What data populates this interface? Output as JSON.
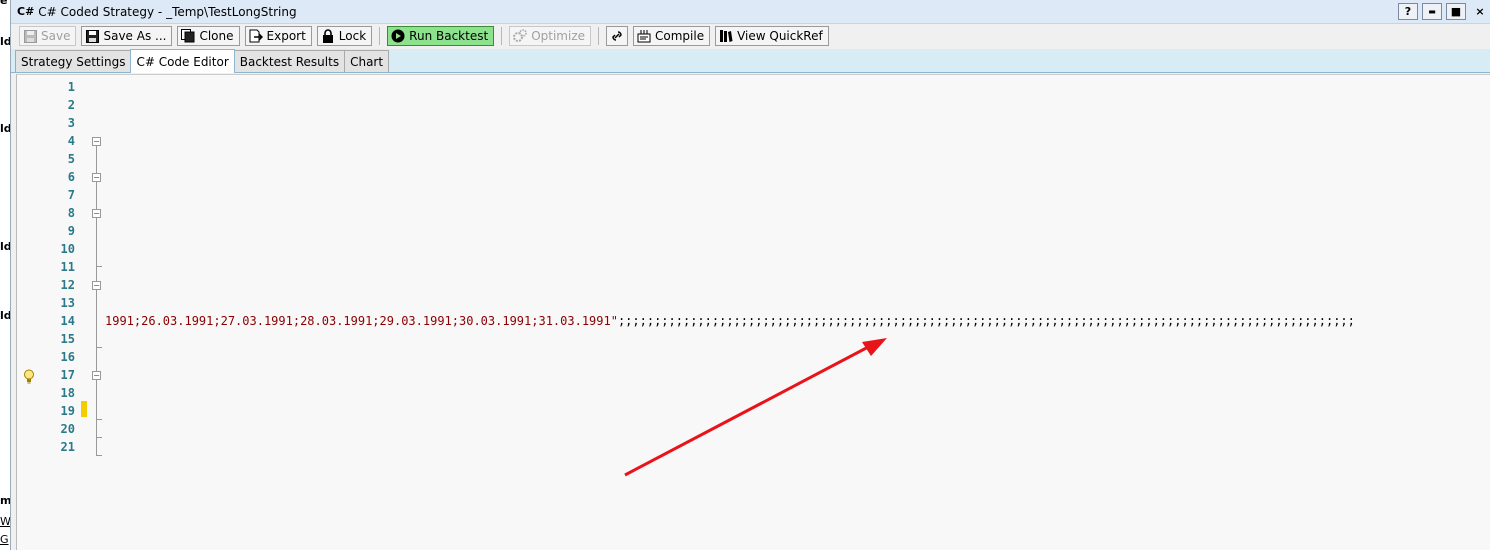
{
  "background_fragments": [
    "e",
    "ld",
    "ld",
    "ld",
    "ld",
    "m",
    "W",
    "G"
  ],
  "title": {
    "icon": "C#",
    "text": "C# Coded Strategy - _Temp\\TestLongString"
  },
  "window_controls": {
    "help": "?",
    "minimize": "▬",
    "maximize": "■",
    "close": "×"
  },
  "toolbar": {
    "save": "Save",
    "save_as": "Save As ...",
    "clone": "Clone",
    "export": "Export",
    "lock": "Lock",
    "run_backtest": "Run Backtest",
    "optimize": "Optimize",
    "compile": "Compile",
    "view_quickref": "View QuickRef"
  },
  "tabs": [
    {
      "label": "Strategy Settings"
    },
    {
      "label": "C# Code Editor"
    },
    {
      "label": "Backtest Results"
    },
    {
      "label": "Chart"
    }
  ],
  "editor": {
    "line_numbers": [
      "1",
      "2",
      "3",
      "4",
      "5",
      "6",
      "7",
      "8",
      "9",
      "10",
      "11",
      "12",
      "13",
      "14",
      "15",
      "16",
      "17",
      "18",
      "19",
      "20",
      "21"
    ],
    "line_14_text": "1991;26.03.1991;27.03.1991;28.03.1991;29.03.1991;30.03.1991;31.03.1991\"",
    "line_14_tail": ";;;;;;;;;;;;;;;;;;;;;;;;;;;;;;;;;;;;;;;;;;;;;;;;;;;;;;;;;;;;;;;;;;;;;;;;;;;;;;;;;;;;;;;;;;;;;;;;;;;;;;"
  },
  "colors": {
    "arrow": "#e8141a",
    "run_button": "#8de38d",
    "tab_strip": "#d8ecf5",
    "string_text": "#8b0000",
    "line_numbers": "#2a7a8a",
    "change_marker": "#f5cc00"
  },
  "icons": {
    "save": "floppy-icon",
    "save_as": "floppy-icon",
    "clone": "copy-icon",
    "export": "export-icon",
    "lock": "lock-icon",
    "run_backtest": "play-icon",
    "optimize": "gears-icon",
    "link": "link-icon",
    "compile": "compile-icon",
    "view_quickref": "books-icon",
    "bulb": "lightbulb-icon"
  }
}
